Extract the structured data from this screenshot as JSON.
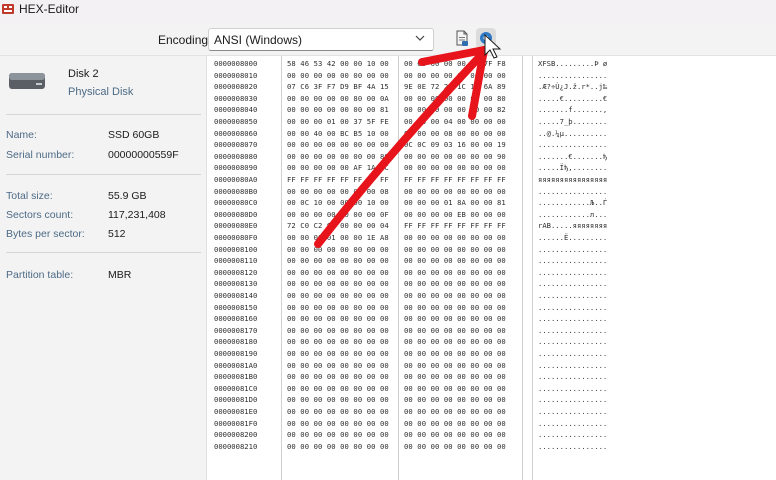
{
  "window": {
    "title": "HEX-Editor",
    "app_icon": "hex-editor-icon"
  },
  "toolbar": {
    "encoding_label": "Encoding",
    "encoding_value": "ANSI (Windows)",
    "save_icon": "save-document-icon",
    "go_icon": "go-icon"
  },
  "disk": {
    "name": "Disk 2",
    "type": "Physical Disk",
    "icon": "hard-disk-icon"
  },
  "properties": [
    {
      "key": "Name:",
      "value": "SSD 60GB"
    },
    {
      "key": "Serial number:",
      "value": "00000000559F"
    },
    {
      "key": "Total size:",
      "value": "55.9 GB"
    },
    {
      "key": "Sectors count:",
      "value": "117,231,408"
    },
    {
      "key": "Bytes per sector:",
      "value": "512"
    },
    {
      "key": "Partition table:",
      "value": "MBR"
    }
  ],
  "hex_rows": [
    {
      "offset": "0000008000",
      "hex1": "58 46 53 42 00 00 10 00",
      "hex2": "00 00 00 00 00 DF 7F F8",
      "ascii": "XFSB.........Þ  ø"
    },
    {
      "offset": "0000008010",
      "hex1": "00 00 00 00 00 00 00 00",
      "hex2": "00 00 00 00 00 00 00 00",
      "ascii": "................"
    },
    {
      "offset": "0000008020",
      "hex1": "07 C6 3F F7 D9 BF 4A 15",
      "hex2": "9E 0E 72 2A 1C 12 6A 89",
      "ascii": ".Æ?÷Ù¿J.ž.r*..j‰"
    },
    {
      "offset": "0000008030",
      "hex1": "00 00 00 00 00 80 00 0A",
      "hex2": "00 00 00 00 00 00 00 80",
      "ascii": ".....€.........€"
    },
    {
      "offset": "0000008040",
      "hex1": "00 00 00 00 00 00 00 81",
      "hex2": "00 00 00 00 00 00 00 82",
      "ascii": ".......f.......‚"
    },
    {
      "offset": "0000008050",
      "hex1": "00 00 00 01 00 37 5F FE",
      "hex2": "00 00 00 04 00 00 00 00",
      "ascii": ".....7_þ........"
    },
    {
      "offset": "0000008060",
      "hex1": "00 00 40 00 BC B5 10 00",
      "hex2": "02 00 00 08 00 00 00 00",
      "ascii": "..@.¼µ.........."
    },
    {
      "offset": "0000008070",
      "hex1": "00 00 00 00 00 00 00 00",
      "hex2": "0C 0C 09 03 16 00 00 19",
      "ascii": "................"
    },
    {
      "offset": "0000008080",
      "hex1": "00 00 00 00 00 00 00 80",
      "hex2": "00 00 00 00 00 00 00 90",
      "ascii": ".......€.......ђ"
    },
    {
      "offset": "0000008090",
      "hex1": "00 00 00 00 00 AF 1A 2C",
      "hex2": "00 00 00 00 00 00 00 00",
      "ascii": ".....Їђ,........"
    },
    {
      "offset": "00000080A0",
      "hex1": "FF FF FF FF FF FF FF FF",
      "hex2": "FF FF FF FF FF FF FF FF",
      "ascii": "яяяяяяяяяяяяяяяя"
    },
    {
      "offset": "00000080B0",
      "hex1": "00 00 00 00 00 00 00 08",
      "hex2": "00 00 00 00 00 00 00 00",
      "ascii": "................"
    },
    {
      "offset": "00000080C0",
      "hex1": "00 0C 10 00 00 00 10 00",
      "hex2": "00 00 00 01 8A 00 00 81",
      "ascii": "............Љ..Ѓ"
    },
    {
      "offset": "00000080D0",
      "hex1": "00 00 00 00 00 00 00 0F",
      "hex2": "00 00 00 00 EB 00 00 00",
      "ascii": "............л..."
    },
    {
      "offset": "00000080E0",
      "hex1": "72 C0 C2 00 00 00 00 04",
      "hex2": "FF FF FF FF FF FF FF FF",
      "ascii": "rАВ.....яяяяяяяя"
    },
    {
      "offset": "00000080F0",
      "hex1": "00 00 00 01 00 00 1E A8",
      "hex2": "00 00 00 00 00 00 00 00",
      "ascii": "......Ё........."
    },
    {
      "offset": "0000008100",
      "hex1": "00 00 00 00 00 00 00 00",
      "hex2": "00 00 00 00 00 00 00 00",
      "ascii": "................"
    },
    {
      "offset": "0000008110",
      "hex1": "00 00 00 00 00 00 00 00",
      "hex2": "00 00 00 00 00 00 00 00",
      "ascii": "................"
    },
    {
      "offset": "0000008120",
      "hex1": "00 00 00 00 00 00 00 00",
      "hex2": "00 00 00 00 00 00 00 00",
      "ascii": "................"
    },
    {
      "offset": "0000008130",
      "hex1": "00 00 00 00 00 00 00 00",
      "hex2": "00 00 00 00 00 00 00 00",
      "ascii": "................"
    },
    {
      "offset": "0000008140",
      "hex1": "00 00 00 00 00 00 00 00",
      "hex2": "00 00 00 00 00 00 00 00",
      "ascii": "................"
    },
    {
      "offset": "0000008150",
      "hex1": "00 00 00 00 00 00 00 00",
      "hex2": "00 00 00 00 00 00 00 00",
      "ascii": "................"
    },
    {
      "offset": "0000008160",
      "hex1": "00 00 00 00 00 00 00 00",
      "hex2": "00 00 00 00 00 00 00 00",
      "ascii": "................"
    },
    {
      "offset": "0000008170",
      "hex1": "00 00 00 00 00 00 00 00",
      "hex2": "00 00 00 00 00 00 00 00",
      "ascii": "................"
    },
    {
      "offset": "0000008180",
      "hex1": "00 00 00 00 00 00 00 00",
      "hex2": "00 00 00 00 00 00 00 00",
      "ascii": "................"
    },
    {
      "offset": "0000008190",
      "hex1": "00 00 00 00 00 00 00 00",
      "hex2": "00 00 00 00 00 00 00 00",
      "ascii": "................"
    },
    {
      "offset": "00000081A0",
      "hex1": "00 00 00 00 00 00 00 00",
      "hex2": "00 00 00 00 00 00 00 00",
      "ascii": "................"
    },
    {
      "offset": "00000081B0",
      "hex1": "00 00 00 00 00 00 00 00",
      "hex2": "00 00 00 00 00 00 00 00",
      "ascii": "................"
    },
    {
      "offset": "00000081C0",
      "hex1": "00 00 00 00 00 00 00 00",
      "hex2": "00 00 00 00 00 00 00 00",
      "ascii": "................"
    },
    {
      "offset": "00000081D0",
      "hex1": "00 00 00 00 00 00 00 00",
      "hex2": "00 00 00 00 00 00 00 00",
      "ascii": "................"
    },
    {
      "offset": "00000081E0",
      "hex1": "00 00 00 00 00 00 00 00",
      "hex2": "00 00 00 00 00 00 00 00",
      "ascii": "................"
    },
    {
      "offset": "00000081F0",
      "hex1": "00 00 00 00 00 00 00 00",
      "hex2": "00 00 00 00 00 00 00 00",
      "ascii": "................"
    },
    {
      "offset": "0000008200",
      "hex1": "00 00 00 00 00 00 00 00",
      "hex2": "00 00 00 00 00 00 00 00",
      "ascii": "................"
    },
    {
      "offset": "0000008210",
      "hex1": "00 00 00 00 00 00 00 00",
      "hex2": "00 00 00 00 00 00 00 00",
      "ascii": "................"
    }
  ],
  "annotation": {
    "color": "#e8141b",
    "icon": "red-arrow-annotation"
  }
}
